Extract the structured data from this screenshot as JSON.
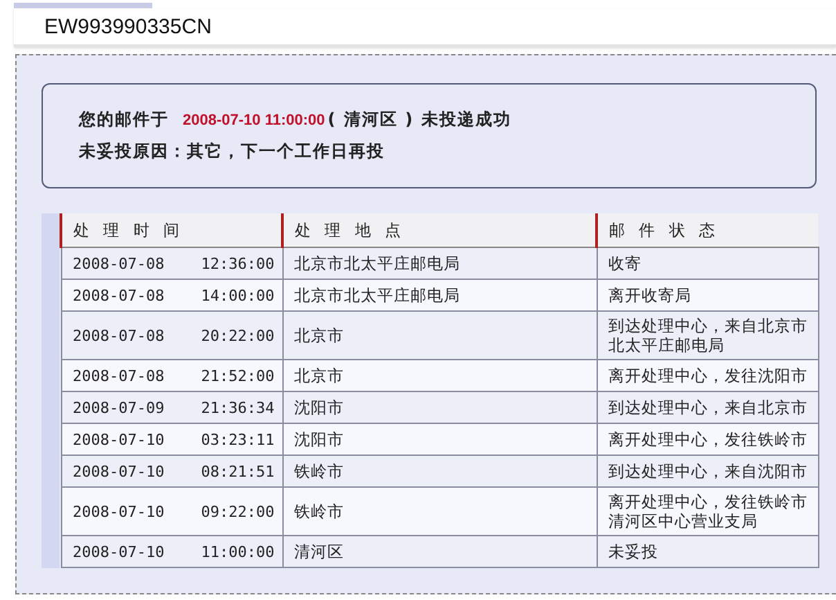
{
  "tracking_number": "EW993990335CN",
  "notice": {
    "prefix": "您的邮件于",
    "time": "2008-07-10 11:00:00",
    "suffix": "( 清河区 ) 未投递成功",
    "reason": "未妥投原因：其它，下一个工作日再投"
  },
  "table": {
    "columns": [
      "处 理 时 间",
      "处 理 地 点",
      "邮 件 状 态"
    ],
    "rows": [
      {
        "date": "2008-07-08",
        "time": "12:36:00",
        "place": "北京市北太平庄邮电局",
        "status": "收寄"
      },
      {
        "date": "2008-07-08",
        "time": "14:00:00",
        "place": "北京市北太平庄邮电局",
        "status": "离开收寄局"
      },
      {
        "date": "2008-07-08",
        "time": "20:22:00",
        "place": "北京市",
        "status": "到达处理中心，来自北京市北太平庄邮电局"
      },
      {
        "date": "2008-07-08",
        "time": "21:52:00",
        "place": "北京市",
        "status": "离开处理中心，发往沈阳市"
      },
      {
        "date": "2008-07-09",
        "time": "21:36:34",
        "place": "沈阳市",
        "status": "到达处理中心，来自北京市"
      },
      {
        "date": "2008-07-10",
        "time": "03:23:11",
        "place": "沈阳市",
        "status": "离开处理中心，发往铁岭市"
      },
      {
        "date": "2008-07-10",
        "time": "08:21:51",
        "place": "铁岭市",
        "status": "到达处理中心，来自沈阳市"
      },
      {
        "date": "2008-07-10",
        "time": "09:22:00",
        "place": "铁岭市",
        "status": "离开处理中心，发往铁岭市清河区中心营业支局"
      },
      {
        "date": "2008-07-10",
        "time": "11:00:00",
        "place": "清河区",
        "status": "未妥投"
      }
    ]
  }
}
